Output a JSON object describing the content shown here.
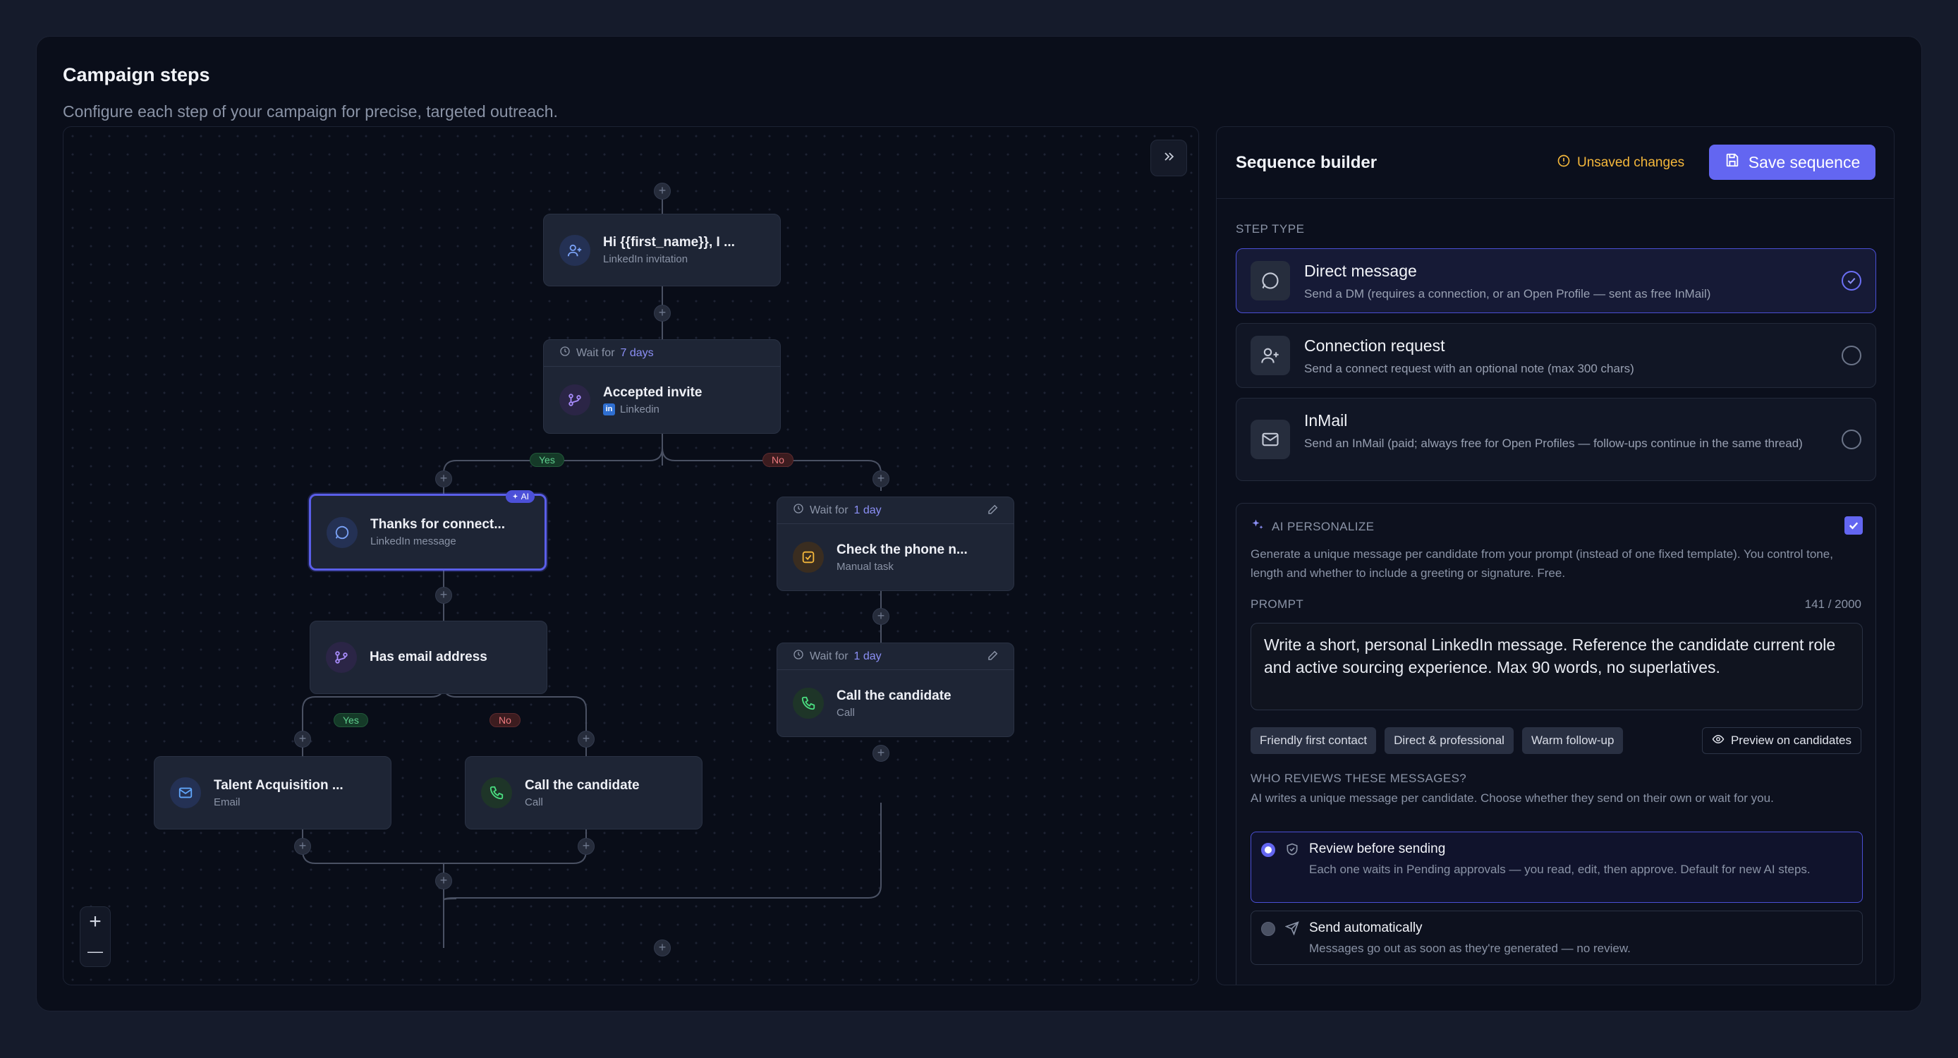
{
  "header": {
    "title": "Campaign steps",
    "subtitle": "Configure each step of your campaign for precise, targeted outreach."
  },
  "nodes": {
    "invite": {
      "title": "Hi {{first_name}}, I ...",
      "subtitle": "LinkedIn invitation"
    },
    "accepted": {
      "wait_prefix": "Wait for",
      "wait_value": "7 days",
      "title": "Accepted invite",
      "subtitle": "Linkedin",
      "badge": "in"
    },
    "thanks": {
      "title": "Thanks for connect...",
      "subtitle": "LinkedIn message",
      "badge": "AI"
    },
    "check": {
      "wait_prefix": "Wait for",
      "wait_value": "1 day",
      "title": "Check the phone n...",
      "subtitle": "Manual task"
    },
    "email_cond": {
      "title": "Has email address"
    },
    "call_right": {
      "wait_prefix": "Wait for",
      "wait_value": "1 day",
      "title": "Call the candidate",
      "subtitle": "Call"
    },
    "talent": {
      "title": "Talent Acquisition ...",
      "subtitle": "Email"
    },
    "call_mid": {
      "title": "Call the candidate",
      "subtitle": "Call"
    }
  },
  "branch_labels": {
    "yes": "Yes",
    "no": "No"
  },
  "zoom": {
    "in": "+",
    "out": "—"
  },
  "sidebar": {
    "title": "Sequence builder",
    "unsaved": "Unsaved changes",
    "save_label": "Save sequence",
    "step_type_label": "STEP TYPE",
    "step_types": [
      {
        "title": "Direct message",
        "desc": "Send a DM (requires a connection, or an Open Profile — sent as free InMail)",
        "selected": true
      },
      {
        "title": "Connection request",
        "desc": "Send a connect request with an optional note (max 300 chars)",
        "selected": false
      },
      {
        "title": "InMail",
        "desc": "Send an InMail (paid; always free for Open Profiles — follow-ups continue in the same thread)",
        "selected": false
      }
    ],
    "ai": {
      "label": "AI PERSONALIZE",
      "enabled": true,
      "desc": "Generate a unique message per candidate from your prompt (instead of one fixed template). You control tone, length and whether to include a greeting or signature. Free.",
      "prompt_label": "PROMPT",
      "count": "141 / 2000",
      "prompt": "Write a short, personal LinkedIn message. Reference the candidate current role and active sourcing experience. Max 90 words, no superlatives.",
      "chips": [
        "Friendly first contact",
        "Direct & professional",
        "Warm follow-up"
      ],
      "preview_label": "Preview on candidates",
      "who_label": "WHO REVIEWS THESE MESSAGES?",
      "who_sub": "AI writes a unique message per candidate. Choose whether they send on their own or wait for you.",
      "options": [
        {
          "title": "Review before sending",
          "desc": "Each one waits in Pending approvals — you read, edit, then approve. Default for new AI steps.",
          "selected": true
        },
        {
          "title": "Send automatically",
          "desc": "Messages go out as soon as they're generated — no review.",
          "selected": false
        }
      ]
    }
  },
  "colors": {
    "accent": "#6366f1",
    "warning": "#f4b73b",
    "yes": "#5fd08f",
    "no": "#ee7a7f"
  }
}
